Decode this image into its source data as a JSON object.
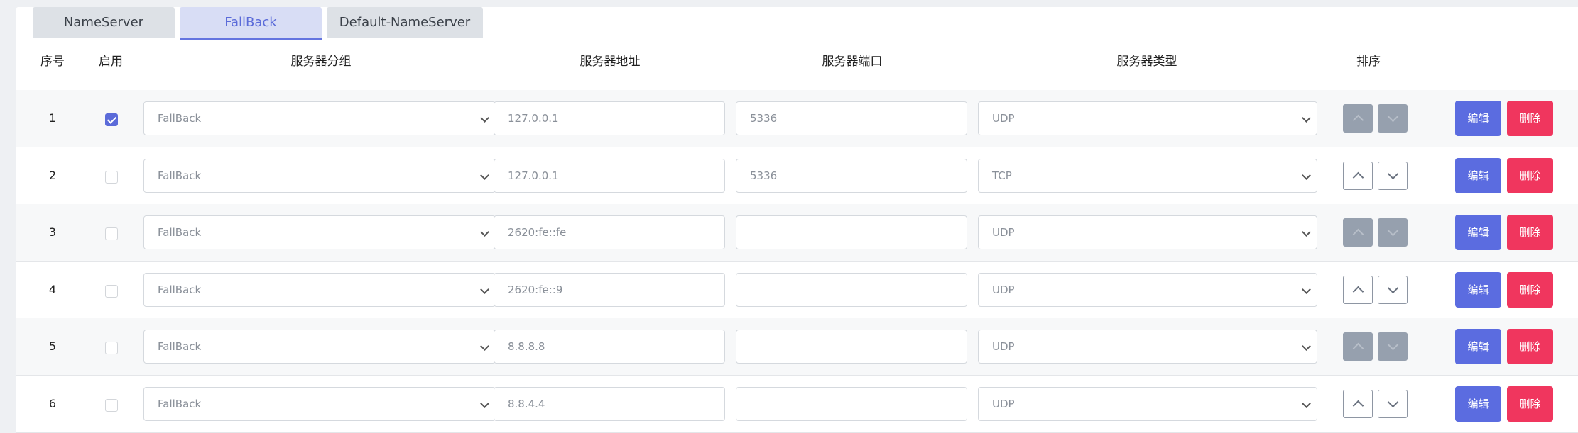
{
  "tabs": [
    {
      "label": "NameServer",
      "active": false
    },
    {
      "label": "FallBack",
      "active": true
    },
    {
      "label": "Default-NameServer",
      "active": false
    }
  ],
  "columns": {
    "index": "序号",
    "enabled": "启用",
    "group": "服务器分组",
    "address": "服务器地址",
    "port": "服务器端口",
    "type": "服务器类型",
    "order": "排序"
  },
  "actions": {
    "edit": "编辑",
    "delete": "删除"
  },
  "rows": [
    {
      "index": "1",
      "enabled": true,
      "group": "FallBack",
      "address": "127.0.0.1",
      "port": "5336",
      "type": "UDP",
      "move_enabled": false
    },
    {
      "index": "2",
      "enabled": false,
      "group": "FallBack",
      "address": "127.0.0.1",
      "port": "5336",
      "type": "TCP",
      "move_enabled": true
    },
    {
      "index": "3",
      "enabled": false,
      "group": "FallBack",
      "address": "2620:fe::fe",
      "port": "",
      "type": "UDP",
      "move_enabled": false
    },
    {
      "index": "4",
      "enabled": false,
      "group": "FallBack",
      "address": "2620:fe::9",
      "port": "",
      "type": "UDP",
      "move_enabled": true
    },
    {
      "index": "5",
      "enabled": false,
      "group": "FallBack",
      "address": "8.8.8.8",
      "port": "",
      "type": "UDP",
      "move_enabled": false
    },
    {
      "index": "6",
      "enabled": false,
      "group": "FallBack",
      "address": "8.8.4.4",
      "port": "",
      "type": "UDP",
      "move_enabled": true
    }
  ],
  "colors": {
    "accent": "#5b6bd9",
    "edit": "#5b6ce0",
    "delete": "#f0365e"
  }
}
